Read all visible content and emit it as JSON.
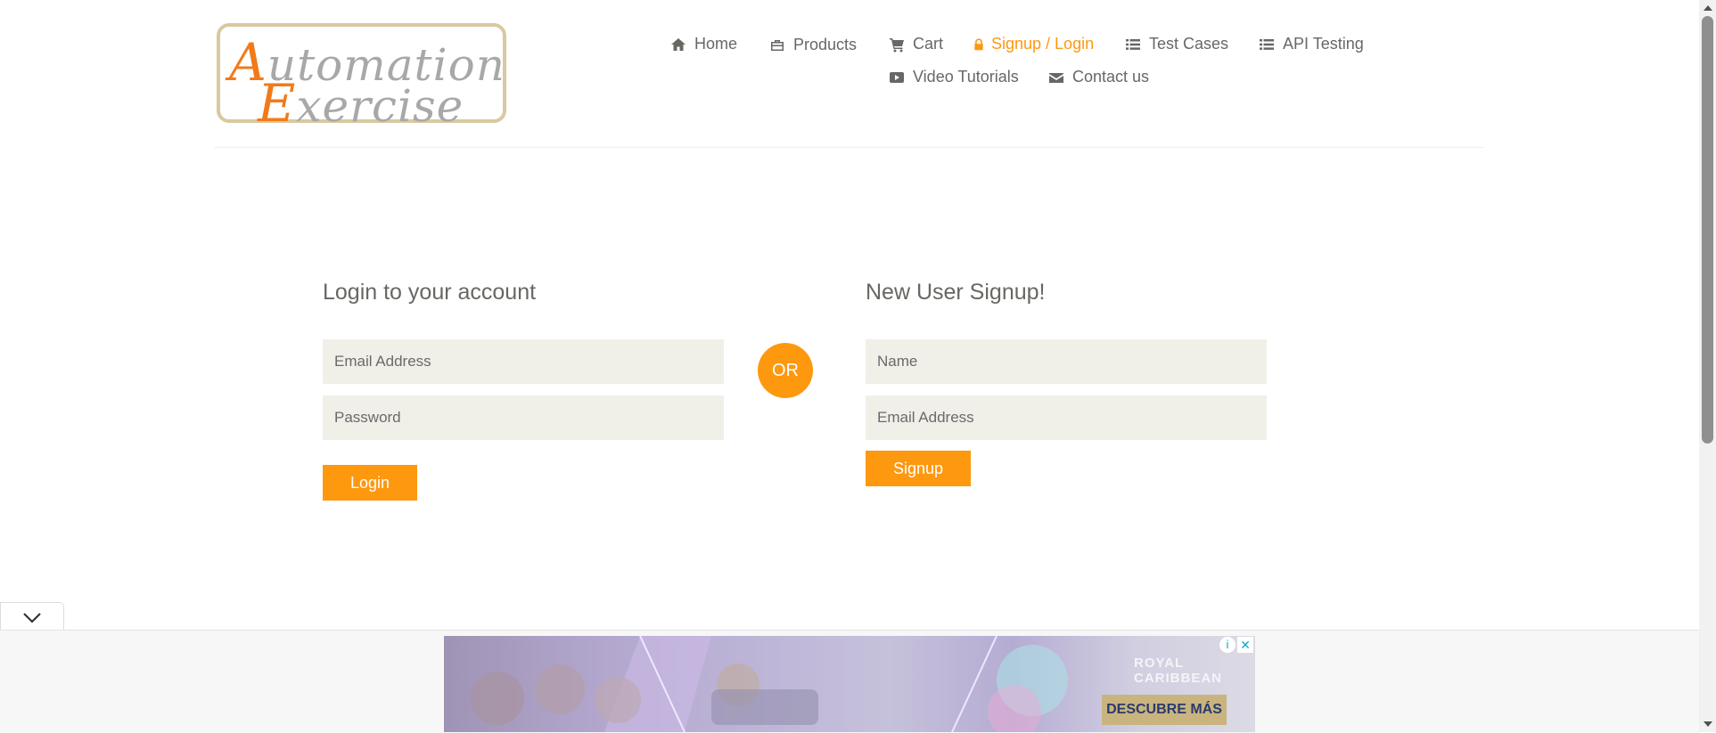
{
  "logo": {
    "line1_cap": "A",
    "line1_rest": "utomation",
    "line2_cap": "E",
    "line2_rest": "xercise"
  },
  "nav": {
    "items": [
      {
        "label": "Home",
        "icon": "home-icon"
      },
      {
        "label": "Products",
        "icon": "briefcase-icon"
      },
      {
        "label": "Cart",
        "icon": "cart-icon"
      },
      {
        "label": "Signup / Login",
        "icon": "lock-icon",
        "active": true
      },
      {
        "label": "Test Cases",
        "icon": "list-icon"
      },
      {
        "label": "API Testing",
        "icon": "list-icon"
      },
      {
        "label": "Video Tutorials",
        "icon": "youtube-play-icon"
      },
      {
        "label": "Contact us",
        "icon": "envelope-icon"
      }
    ]
  },
  "login": {
    "title": "Login to your account",
    "email_placeholder": "Email Address",
    "password_placeholder": "Password",
    "button": "Login"
  },
  "or_label": "OR",
  "signup": {
    "title": "New User Signup!",
    "name_placeholder": "Name",
    "email_placeholder": "Email Address",
    "button": "Signup"
  },
  "ad": {
    "brand_line1": "ROYAL",
    "brand_line2": "CARIBBEAN",
    "cta": "DESCUBRE MÁS",
    "info": "i",
    "close": "✕"
  },
  "colors": {
    "accent": "#fe980f",
    "text": "#696763",
    "field_bg": "#f0f0e9"
  }
}
